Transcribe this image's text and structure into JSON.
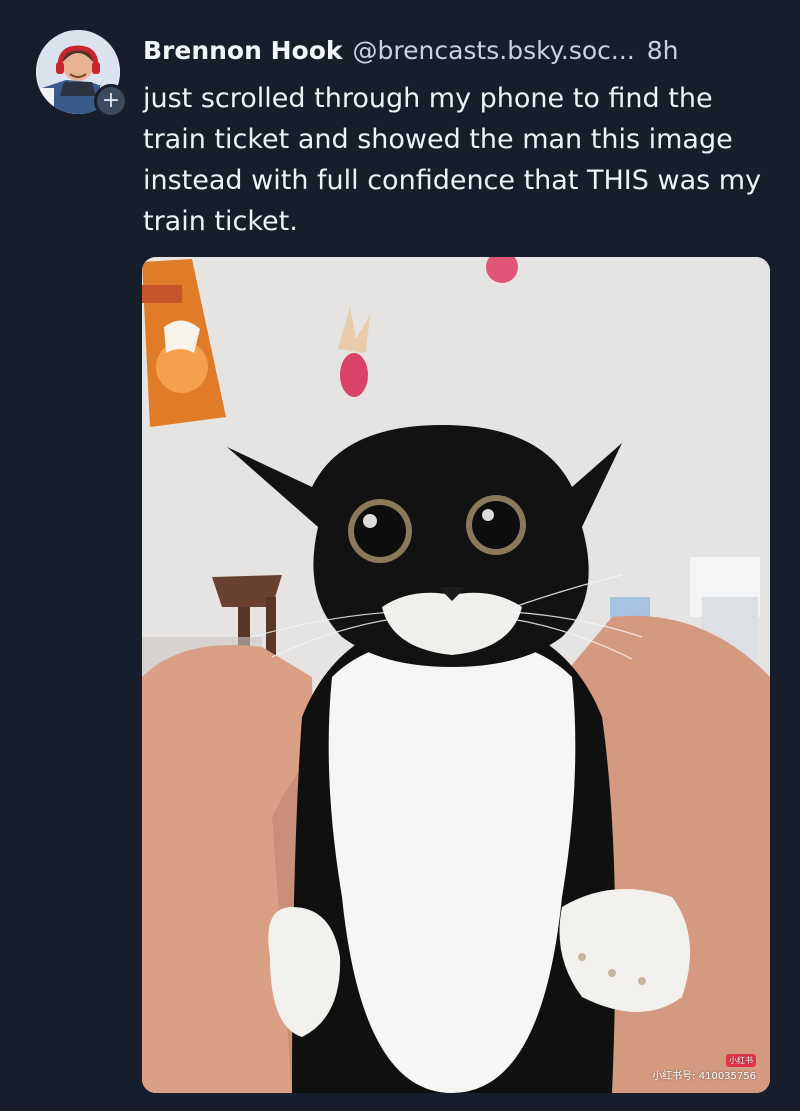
{
  "post": {
    "author": {
      "display_name": "Brennon Hook",
      "handle": "@brencasts.bsky.soc...",
      "avatar_icon": "avatar-icon",
      "follow_badge": "+"
    },
    "timestamp": "8h",
    "text": "just scrolled through my phone to find the train ticket and showed the man this image instead with full confidence that THIS was my train ticket.",
    "image": {
      "subject": "black-and-white cat",
      "watermark_logo": "小红书",
      "watermark_text": "小红书号: 410035756"
    }
  },
  "colors": {
    "background": "#161e2b",
    "text": "#eef2f7",
    "muted_text": "#c9d2dd"
  }
}
